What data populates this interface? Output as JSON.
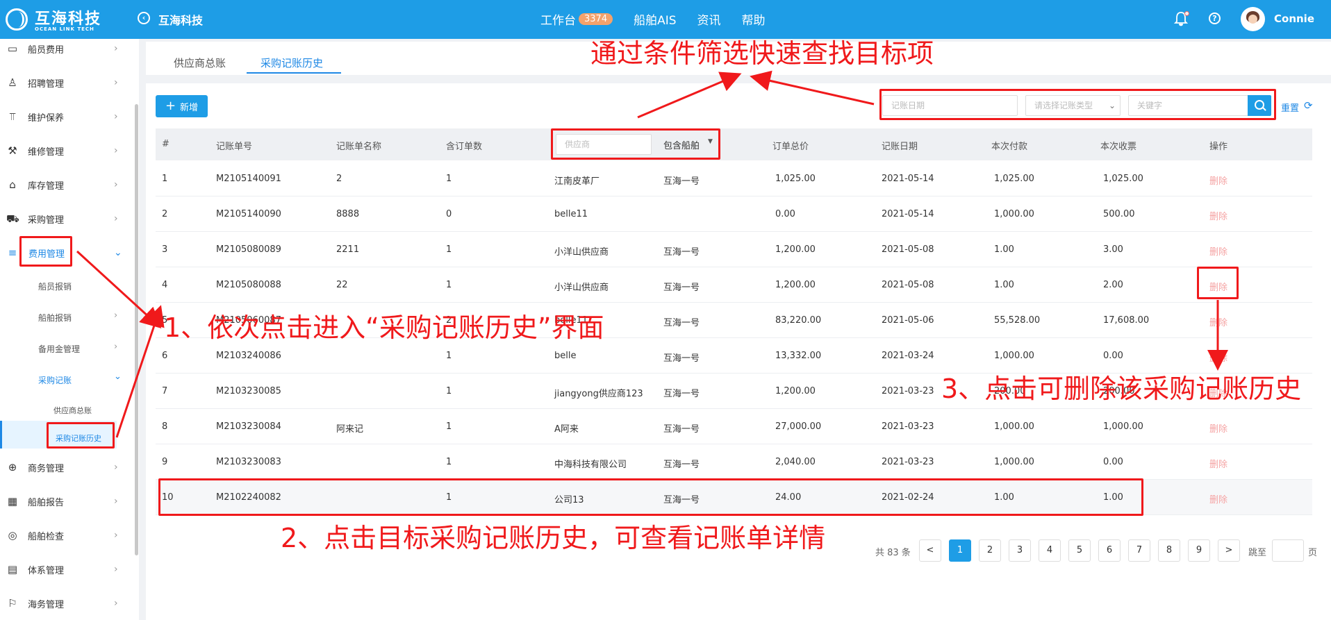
{
  "brand": {
    "name_cn": "互海科技",
    "name_en": "OCEAN LINK TECH"
  },
  "header": {
    "company": "互海科技",
    "nav": [
      {
        "label": "工作台",
        "badge": "3374"
      },
      {
        "label": "船舶AIS"
      },
      {
        "label": "资讯"
      },
      {
        "label": "帮助"
      }
    ],
    "username": "Connie"
  },
  "sidebar": {
    "items": [
      {
        "label": "船员费用",
        "icon": "wallet-icon"
      },
      {
        "label": "招聘管理",
        "icon": "person-icon"
      },
      {
        "label": "维护保养",
        "icon": "wrench-icon"
      },
      {
        "label": "维修管理",
        "icon": "tool-icon"
      },
      {
        "label": "库存管理",
        "icon": "warehouse-icon"
      },
      {
        "label": "采购管理",
        "icon": "cart-icon"
      },
      {
        "label": "费用管理",
        "icon": "database-icon"
      },
      {
        "label": "商务管理",
        "icon": "globe-icon"
      },
      {
        "label": "船舶报告",
        "icon": "calendar-icon"
      },
      {
        "label": "船舶检查",
        "icon": "check-circle-icon"
      },
      {
        "label": "体系管理",
        "icon": "document-icon"
      },
      {
        "label": "海务管理",
        "icon": "signpost-icon"
      }
    ],
    "sub": [
      "船员报销",
      "船舶报销",
      "备用金管理",
      "采购记账"
    ],
    "subsub": [
      "供应商总账",
      "采购记账历史"
    ]
  },
  "tabs": [
    "供应商总账",
    "采购记账历史"
  ],
  "toolbar": {
    "add_label": "新增",
    "reset_label": "重置"
  },
  "filters": {
    "date_placeholder": "记账日期",
    "type_placeholder": "请选择记账类型",
    "keyword_placeholder": "关键字",
    "supplier_placeholder": "供应商",
    "ship_label": "包含船舶"
  },
  "table": {
    "headers": [
      "#",
      "记账单号",
      "记账单名称",
      "含订单数",
      "",
      "",
      "订单总价",
      "记账日期",
      "本次付款",
      "本次收票",
      "操作"
    ],
    "rows": [
      [
        "1",
        "M2105140091",
        "2",
        "1",
        "江南皮革厂",
        "互海一号",
        "1,025.00",
        "2021-05-14",
        "1,025.00",
        "1,025.00",
        "删除"
      ],
      [
        "2",
        "M2105140090",
        "8888",
        "0",
        "belle11",
        "",
        "0.00",
        "2021-05-14",
        "1,000.00",
        "500.00",
        "删除"
      ],
      [
        "3",
        "M2105080089",
        "2211",
        "1",
        "小洋山供应商",
        "互海一号",
        "1,200.00",
        "2021-05-08",
        "1.00",
        "3.00",
        "删除"
      ],
      [
        "4",
        "M2105080088",
        "22",
        "1",
        "小洋山供应商",
        "互海一号",
        "1,200.00",
        "2021-05-08",
        "1.00",
        "2.00",
        "删除"
      ],
      [
        "5",
        "M2105060087",
        "",
        "2",
        "belle11",
        "互海一号",
        "83,220.00",
        "2021-05-06",
        "55,528.00",
        "17,608.00",
        "删除"
      ],
      [
        "6",
        "M2103240086",
        "",
        "1",
        "belle",
        "互海一号",
        "13,332.00",
        "2021-03-24",
        "1,000.00",
        "0.00",
        "删除"
      ],
      [
        "7",
        "M2103230085",
        "",
        "1",
        "jiangyong供应商123",
        "互海一号",
        "1,200.00",
        "2021-03-23",
        "200.00",
        "200.00",
        "删除"
      ],
      [
        "8",
        "M2103230084",
        "阿来记",
        "1",
        "A阿来",
        "互海一号",
        "27,000.00",
        "2021-03-23",
        "1,000.00",
        "1,000.00",
        "删除"
      ],
      [
        "9",
        "M2103230083",
        "",
        "1",
        "中海科技有限公司",
        "互海一号",
        "2,040.00",
        "2021-03-23",
        "1,000.00",
        "0.00",
        "删除"
      ],
      [
        "10",
        "M2102240082",
        "",
        "1",
        "公司13",
        "互海一号",
        "24.00",
        "2021-02-24",
        "1.00",
        "1.00",
        "删除"
      ]
    ]
  },
  "pagination": {
    "total": "共 83 条",
    "prev": "<",
    "next": ">",
    "pages": [
      "1",
      "2",
      "3",
      "4",
      "5",
      "6",
      "7",
      "8",
      "9"
    ],
    "jump_label": "跳至",
    "page_label": "页"
  },
  "annotations": {
    "filter_note": "通过条件筛选快速查找目标项",
    "step1": "1、依次点击进入“采购记账历史”界面",
    "step2": "2、点击目标采购记账历史，可查看记账单详情",
    "step3": "3、点击可删除该采购记账历史",
    "color": "#f0191b"
  },
  "colors": {
    "primary": "#1e9de6",
    "badge": "#f5a26b",
    "delete": "#f5a3a3"
  }
}
